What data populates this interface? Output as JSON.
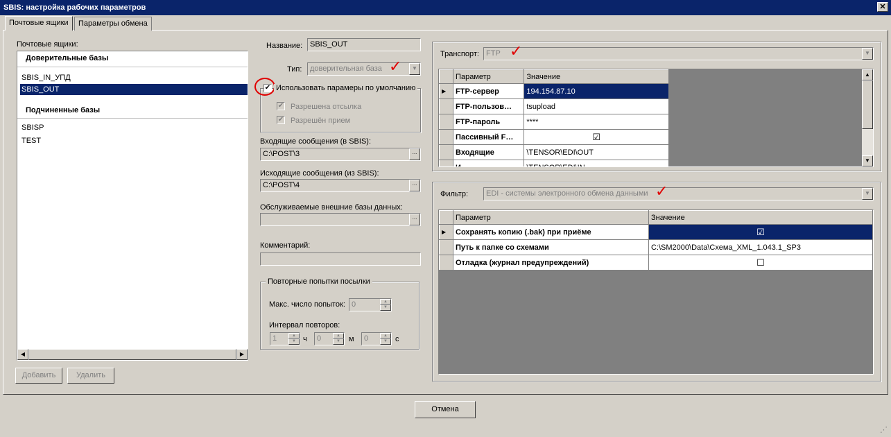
{
  "window": {
    "title": "SBIS: настройка рабочих параметров",
    "close": "✕"
  },
  "tabs": [
    {
      "label": "Почтовые ящики"
    },
    {
      "label": "Параметры обмена"
    }
  ],
  "mailboxes": {
    "label": "Почтовые ящики:",
    "trusted_header": "Доверительные базы",
    "trusted": [
      "SBIS_IN_УПД",
      "SBIS_OUT"
    ],
    "sub_header": "Подчиненные базы",
    "sub": [
      "SBISP",
      "TEST"
    ],
    "add_btn": "Добавить",
    "delete_btn": "Удалить"
  },
  "settings": {
    "name_label": "Название:",
    "name_value": "SBIS_OUT",
    "type_label": "Тип:",
    "type_value": "доверительная база",
    "use_defaults_label": "Использовать парамеры по умолчанию",
    "allow_send_label": "Разрешена отсылка",
    "allow_receive_label": "Разрешён прием",
    "incoming_label": "Входящие сообщения (в SBIS):",
    "incoming_value": "C:\\POST\\3",
    "outgoing_label": "Исходящие сообщения (из SBIS):",
    "outgoing_value": "C:\\POST\\4",
    "external_db_label": "Обслуживаемые внешние базы данных:",
    "comment_label": "Комментарий:",
    "browse": "...",
    "retry_group": "Повторные попытки посылки",
    "max_tries_label": "Макс. число попыток:",
    "max_tries_value": "0",
    "interval_label": "Интервал повторов:",
    "interval_h": "1",
    "h_unit": "ч",
    "interval_m": "0",
    "m_unit": "м",
    "interval_s": "0",
    "s_unit": "с"
  },
  "transport": {
    "label": "Транспорт:",
    "value": "FTP",
    "col_param": "Параметр",
    "col_value": "Значение",
    "rows": [
      {
        "name": "FTP-сервер",
        "value": "194.154.87.10"
      },
      {
        "name": "FTP-пользов…",
        "value": "tsupload"
      },
      {
        "name": "FTP-пароль",
        "value": "****"
      },
      {
        "name": "Пассивный F…",
        "value": "☑"
      },
      {
        "name": "Входящие",
        "value": "\\TENSOR\\EDI\\OUT"
      },
      {
        "name": "И…",
        "value": "\\TENSOR\\EDI\\IN"
      }
    ]
  },
  "filter": {
    "label": "Фильтр:",
    "value": "EDI - системы электронного обмена данными",
    "col_param": "Параметр",
    "col_value": "Значение",
    "rows": [
      {
        "name": "Сохранять копию (.bak) при приёме",
        "value": "☑"
      },
      {
        "name": "Путь к папке со схемами",
        "value": "C:\\SM2000\\Data\\Схема_XML_1.043.1_SP3"
      },
      {
        "name": "Отладка (журнал предупреждений)",
        "value": "☐"
      }
    ]
  },
  "footer": {
    "cancel": "Отмена"
  }
}
